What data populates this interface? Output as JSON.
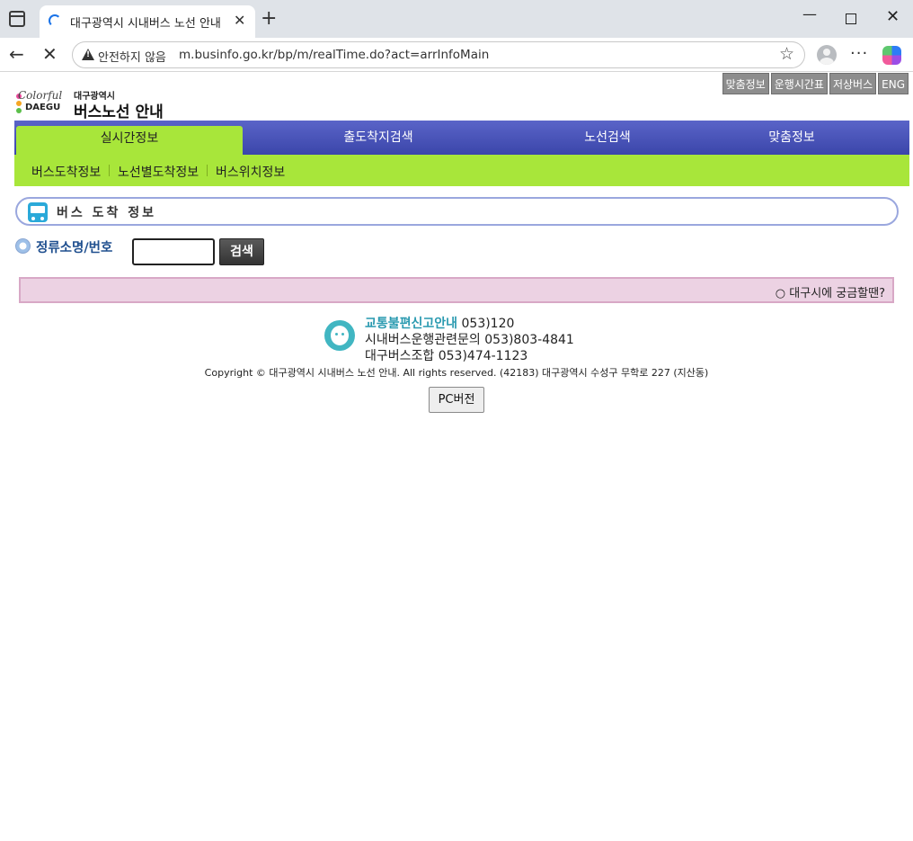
{
  "browser": {
    "tab_title": "대구광역시 시내버스 노선 안내",
    "tab_close": "✕",
    "new_tab": "+",
    "security_label": "안전하지 않음",
    "url": "m.businfo.go.kr/bp/m/realTime.do?act=arrInfoMain",
    "back": "←",
    "stop": "✕",
    "star": "☆",
    "more": "···",
    "win_min": "—",
    "win_close": "✕"
  },
  "logo": {
    "colorful": "Colorful",
    "daegu": "DAEGU",
    "city": "대구광역시",
    "title": "버스노선 안내",
    "dot_colors": [
      "#e94a9b",
      "#f6a623",
      "#5bbf4a"
    ]
  },
  "util_links": [
    {
      "label": "맞춤정보"
    },
    {
      "label": "운행시간표"
    },
    {
      "label": "저상버스"
    },
    {
      "label": "ENG"
    }
  ],
  "main_nav": [
    {
      "label": "실시간정보",
      "active": true
    },
    {
      "label": "출도착지검색",
      "active": false
    },
    {
      "label": "노선검색",
      "active": false
    },
    {
      "label": "맞춤정보",
      "active": false
    }
  ],
  "sub_nav": [
    {
      "label": "버스도착정보"
    },
    {
      "label": "노선별도착정보"
    },
    {
      "label": "버스위치정보"
    }
  ],
  "section": {
    "title": "버스 도착 정보"
  },
  "search": {
    "label": "정류소명/번호",
    "value": "",
    "button": "검색"
  },
  "notice": {
    "text": "○ 대구시에 궁금할땐?"
  },
  "footer": {
    "report_label": "교통불편신고안내",
    "report_number": "053)120",
    "line2": "시내버스운행관련문의 053)803-4841",
    "line3": "대구버스조합 053)474-1123",
    "copyright": "Copyright © 대구광역시 시내버스 노선 안내. All rights reserved. (42183) 대구광역시 수성구 무학로 227 (지산동)",
    "pc_button": "PC버전"
  },
  "colors": {
    "nav_blue": "#3b46aa",
    "nav_green": "#a8e63a",
    "notice_pink": "#ecd2e3",
    "link_blue": "#1f4f8f",
    "accent_teal": "#2a9ab0"
  }
}
